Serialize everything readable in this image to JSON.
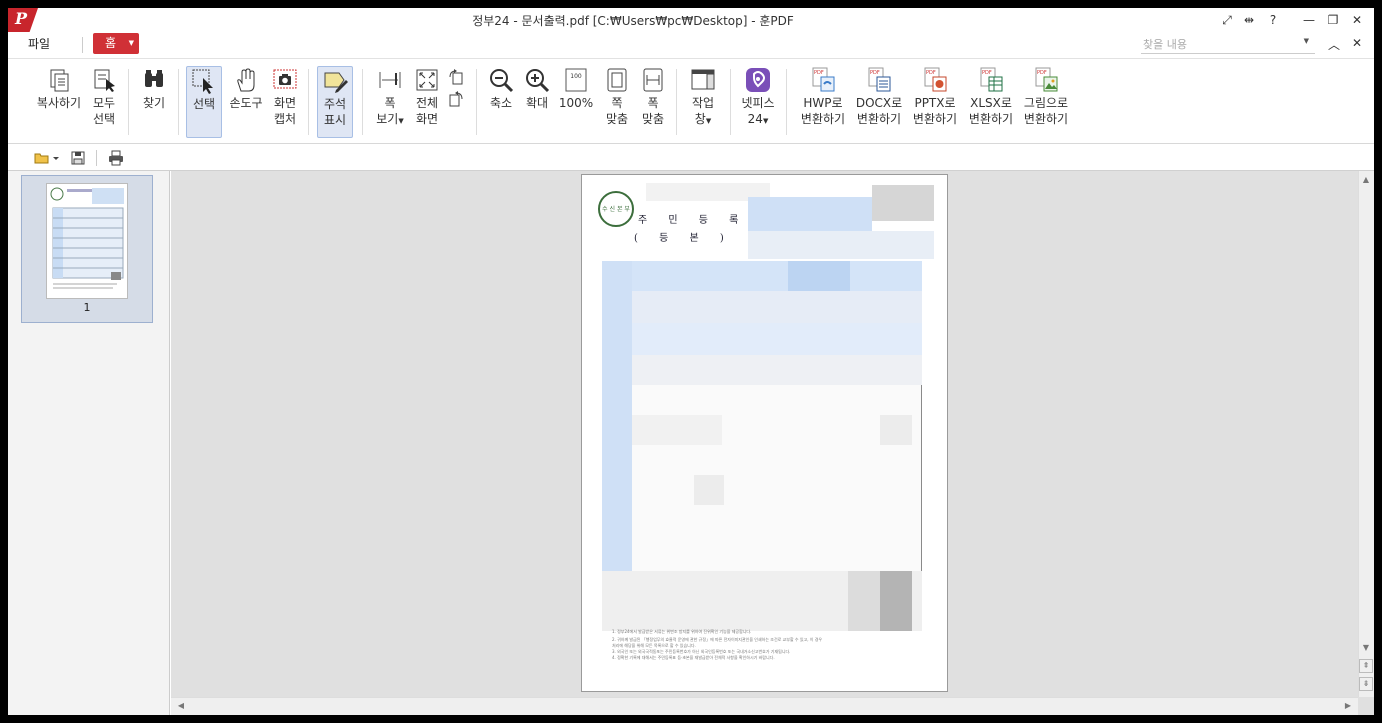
{
  "window": {
    "title": "정부24 - 문서출력.pdf [C:₩Users₩pc₩Desktop] - 훈PDF",
    "logo_letter": "P"
  },
  "menubar": {
    "file": "파일",
    "home": "홈",
    "search_placeholder": "찾을 내용"
  },
  "ribbon": {
    "copy": "복사하기",
    "select_all_1": "모두",
    "select_all_2": "선택",
    "find": "찾기",
    "select": "선택",
    "hand_tool": "손도구",
    "capture_1": "화면",
    "capture_2": "캡처",
    "annot_1": "주석",
    "annot_2": "표시",
    "width_view_1": "폭",
    "width_view_2": "보기",
    "full_1": "전체",
    "full_2": "화면",
    "zoom_out": "축소",
    "zoom_in": "확대",
    "zoom_100": "100%",
    "fit_page_1": "쪽",
    "fit_page_2": "맞춤",
    "fit_width_1": "폭",
    "fit_width_2": "맞춤",
    "task_1": "작업",
    "task_2": "창",
    "netpis_1": "넷피스",
    "netpis_2": "24",
    "hwp_1": "HWP로",
    "hwp_2": "변환하기",
    "docx_1": "DOCX로",
    "docx_2": "변환하기",
    "pptx_1": "PPTX로",
    "pptx_2": "변환하기",
    "xlsx_1": "XLSX로",
    "xlsx_2": "변환하기",
    "img_1": "그림으로",
    "img_2": "변환하기",
    "pdf_tag": "PDF",
    "hundred_tag": "100"
  },
  "sidebar": {
    "page_number": "1"
  },
  "document": {
    "heading": "주 민 등 록 표",
    "subheading": "( 등    본 )",
    "seal_text": "수 신 본 부",
    "notes": [
      "1. 정부24에서 발급받은 서류는 위변조 방지를 위하여 진위확인 기능을 제공합니다.",
      "2. 귀하께 발급된 「행정업무의 효율적 운영에 관한 규정」에 따른 전자이미지관인을 인쇄하는 조건로 교부할 수 있고, 이 경우",
      "   처리에 해당을 위해 모든 목록으로 할 수 있습니다.",
      "3. 외국인 또는 외국국적동포는 주민등록번호가 아닌 외국인등록번호 또는 국내거소신고번호가 기재됩니다.",
      "4. 정확한 기록에 대해서는 주민등록표 등·초본을 재발급받아 전체적 사항을 확인하시기 바랍니다."
    ]
  },
  "colors": {
    "brand": "#c8252c",
    "home_tab": "#d03036",
    "active_bg": "#dfe6f4",
    "active_border": "#a8bfe5",
    "viewer_bg": "#e0e0e0",
    "netpis": "#7a4fb8"
  }
}
